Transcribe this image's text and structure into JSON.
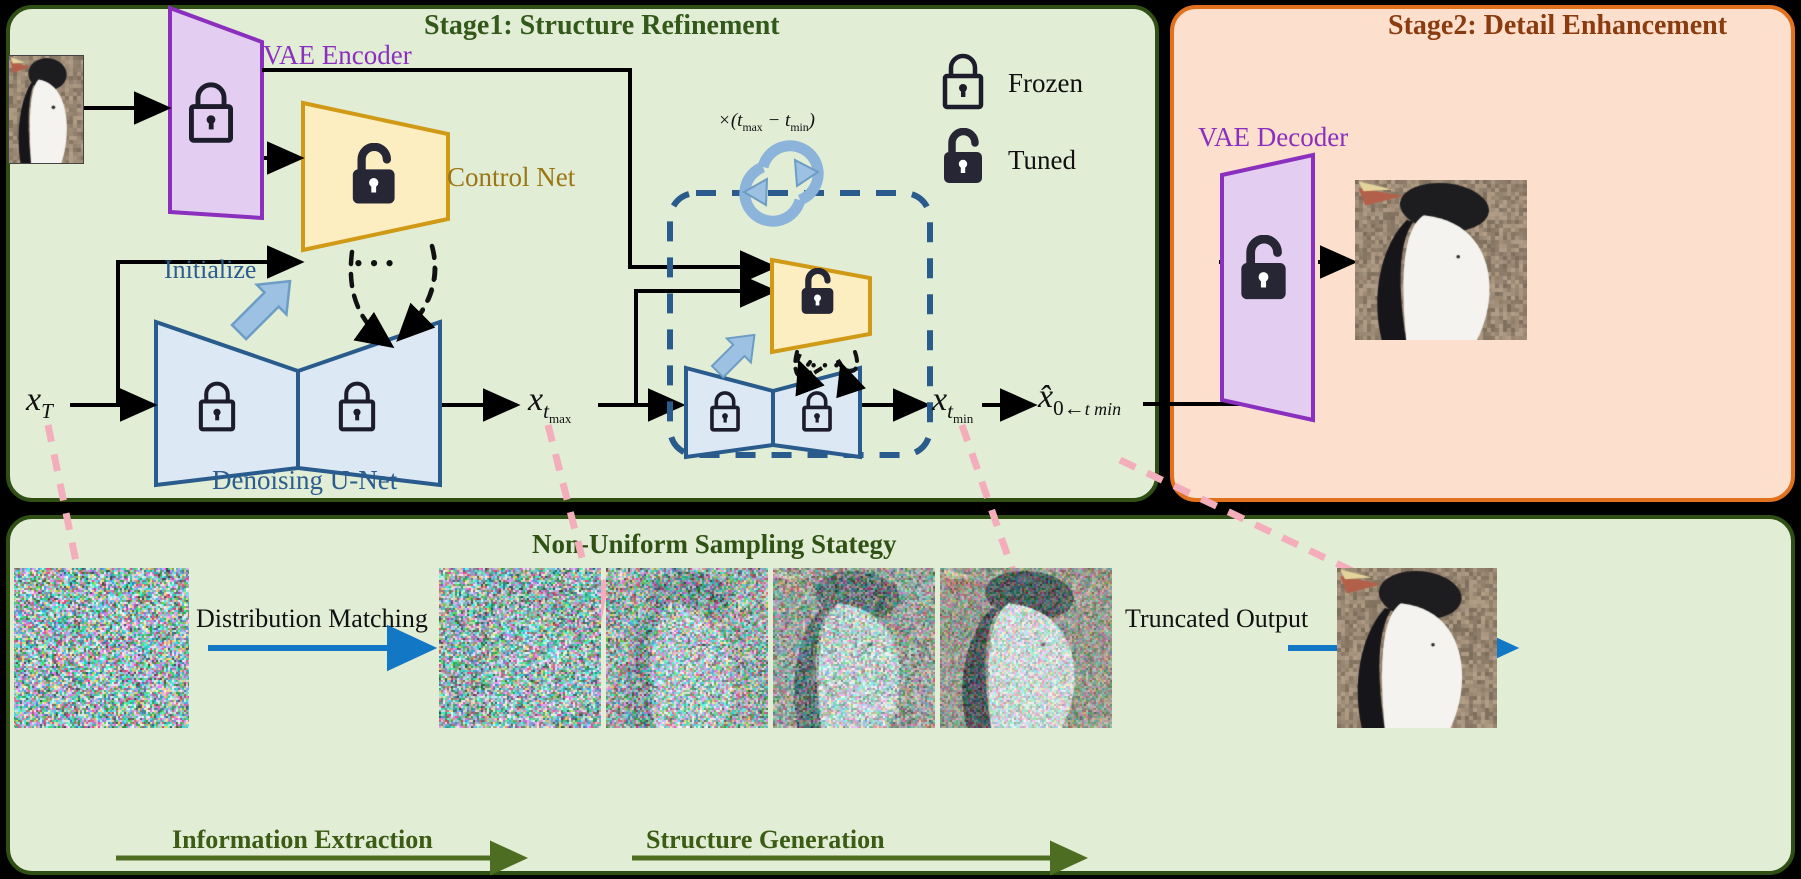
{
  "panels": {
    "stage1": {
      "title": "Stage1: Structure Refinement",
      "color": "#33591a",
      "bg": "#e2edd6",
      "border": "#2f4f14"
    },
    "stage2": {
      "title": "Stage2: Detail Enhancement",
      "color": "#8a3b10",
      "bg": "#fce0cd",
      "border": "#e2711d"
    },
    "sampling": {
      "title": "Non-Uniform Sampling Stategy",
      "color": "#2f5214",
      "bg": "#e2edd6",
      "border": "#2f4f14"
    }
  },
  "components": {
    "vae_encoder": {
      "label": "VAE Encoder",
      "color": "#8b2fbe",
      "lock": "frozen"
    },
    "control_net": {
      "label": "Control Net",
      "color": "#9a7614",
      "lock": "tuned"
    },
    "denoising_unet": {
      "label": "Denoising U-Net",
      "color": "#2d5d8e",
      "lock": "frozen"
    },
    "vae_decoder": {
      "label": "VAE Decoder",
      "color": "#8b2fbe",
      "lock": "tuned"
    },
    "control_net_loop": {
      "label": "",
      "color": "#9a7614",
      "lock": "tuned"
    },
    "denoising_unet_loop": {
      "label": "",
      "color": "#2d5d8e",
      "lock": "frozen"
    }
  },
  "legend": {
    "frozen": {
      "label": "Frozen",
      "icon": "closed-lock-icon"
    },
    "tuned": {
      "label": "Tuned",
      "icon": "open-lock-icon"
    }
  },
  "annotations": {
    "initialize": "Initialize",
    "loop_multiplier_times": "×(",
    "loop_multiplier": "×(t_max − t_min)",
    "ellipsis": "• • •"
  },
  "math_labels": {
    "x_T": {
      "base": "x",
      "sub": "T"
    },
    "x_tmax": {
      "base": "x",
      "sub": "t",
      "subsub": "max"
    },
    "x_tmin": {
      "base": "x",
      "sub": "t",
      "subsub": "min"
    },
    "x_hat_0": {
      "base": "x̂",
      "sub": "0←",
      "subsub": "t min"
    }
  },
  "sampling": {
    "distribution_matching": "Distribution Matching",
    "truncated_output": "Truncated Output",
    "information_extraction": "Information Extraction",
    "structure_generation": "Structure Generation",
    "tiles": [
      {
        "name": "noise-tile-xT",
        "noise": 1.0
      },
      {
        "name": "noise-tile-tmax",
        "noise": 0.95
      },
      {
        "name": "noise-tile-2",
        "noise": 0.8
      },
      {
        "name": "noise-tile-3",
        "noise": 0.62
      },
      {
        "name": "noise-tile-tmin",
        "noise": 0.45
      },
      {
        "name": "output-image",
        "noise": 0.0
      }
    ]
  },
  "images": {
    "input_image": "penguin-input-thumbnail",
    "stage2_output": "penguin-output-thumbnail",
    "final_output": "penguin-final-output"
  },
  "colors": {
    "green_panel_bg": "#e2edd6",
    "green_panel_border": "#2f4f14",
    "orange_panel_bg": "#fce0cd",
    "orange_panel_border": "#e2711d",
    "vae_fill": "#e3cdf0",
    "vae_stroke": "#8b2fbe",
    "control_fill": "#fdeec2",
    "control_stroke": "#d09a16",
    "unet_fill": "#dde8f5",
    "unet_stroke": "#2a5b8d",
    "lock_dark": "#262635",
    "arrow_black": "#000000",
    "arrow_blue": "#1277c4",
    "arrow_pink": "#f6b8c0",
    "arrow_steel": "#8cb4da",
    "dashed_box": "#2a5b8d",
    "phase_arrow_green": "#4d6e22"
  }
}
